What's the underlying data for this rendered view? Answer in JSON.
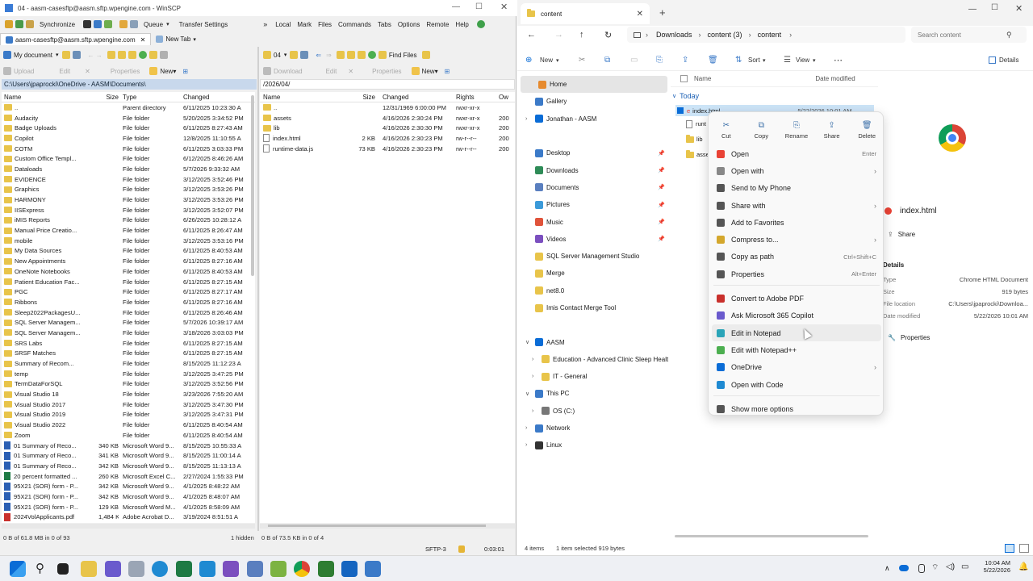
{
  "winscp": {
    "title": "04 - aasm-casesftp@aasm.sftp.wpengine.com - WinSCP",
    "toolbar1": [
      "Synchronize",
      "Queue",
      "Transfer Settings"
    ],
    "menu": [
      "Local",
      "Mark",
      "Files",
      "Commands",
      "Tabs",
      "Options",
      "Remote",
      "Help"
    ],
    "session_tab": "aasm-casesftp@aasm.sftp.wpengine.com",
    "new_tab": "New Tab",
    "left": {
      "location": "My document",
      "new_label": "New",
      "upload": "Upload",
      "edit": "Edit",
      "properties": "Properties",
      "path": "C:\\Users\\jpaprocki\\OneDrive - AASM\\Documents\\",
      "cols": [
        "Name",
        "Size",
        "Type",
        "Changed"
      ],
      "rows": [
        [
          "..",
          "",
          "Parent directory",
          "6/11/2025 10:23:30 A",
          "up"
        ],
        [
          "Audacity",
          "",
          "File folder",
          "5/20/2025 3:34:52 PM",
          "f"
        ],
        [
          "Badge Uploads",
          "",
          "File folder",
          "6/11/2025 8:27:43 AM",
          "f"
        ],
        [
          "Copilot",
          "",
          "File folder",
          "12/8/2025 11:10:55 A",
          "f"
        ],
        [
          "COTM",
          "",
          "File folder",
          "6/11/2025 3:03:33 PM",
          "f"
        ],
        [
          "Custom Office Templ...",
          "",
          "File folder",
          "6/12/2025 8:46:26 AM",
          "f"
        ],
        [
          "Dataloads",
          "",
          "File folder",
          "5/7/2026 9:33:32 AM",
          "f"
        ],
        [
          "EVIDENCE",
          "",
          "File folder",
          "3/12/2025 3:52:46 PM",
          "f"
        ],
        [
          "Graphics",
          "",
          "File folder",
          "3/12/2025 3:53:26 PM",
          "f"
        ],
        [
          "HARMONY",
          "",
          "File folder",
          "3/12/2025 3:53:26 PM",
          "f"
        ],
        [
          "IISExpress",
          "",
          "File folder",
          "3/12/2025 3:52:07 PM",
          "f"
        ],
        [
          "iMIS Reports",
          "",
          "File folder",
          "6/26/2025 10:28:12 A",
          "f"
        ],
        [
          "Manual Price Creatio...",
          "",
          "File folder",
          "6/11/2025 8:26:47 AM",
          "f"
        ],
        [
          "mobile",
          "",
          "File folder",
          "3/12/2025 3:53:16 PM",
          "f"
        ],
        [
          "My Data Sources",
          "",
          "File folder",
          "6/11/2025 8:40:53 AM",
          "f"
        ],
        [
          "New Appointments",
          "",
          "File folder",
          "6/11/2025 8:27:16 AM",
          "f"
        ],
        [
          "OneNote Notebooks",
          "",
          "File folder",
          "6/11/2025 8:40:53 AM",
          "f"
        ],
        [
          "Patient Education Fac...",
          "",
          "File folder",
          "6/11/2025 8:27:15 AM",
          "f"
        ],
        [
          "PGC",
          "",
          "File folder",
          "6/11/2025 8:27:17 AM",
          "f"
        ],
        [
          "Ribbons",
          "",
          "File folder",
          "6/11/2025 8:27:16 AM",
          "f"
        ],
        [
          "Sleep2022PackagesU...",
          "",
          "File folder",
          "6/11/2025 8:26:46 AM",
          "f"
        ],
        [
          "SQL Server Managem...",
          "",
          "File folder",
          "5/7/2026 10:39:17 AM",
          "f"
        ],
        [
          "SQL Server Managem...",
          "",
          "File folder",
          "3/18/2026 3:03:03 PM",
          "f"
        ],
        [
          "SRS Labs",
          "",
          "File folder",
          "6/11/2025 8:27:15 AM",
          "f"
        ],
        [
          "SRSF Matches",
          "",
          "File folder",
          "6/11/2025 8:27:15 AM",
          "f"
        ],
        [
          "Summary of Recom...",
          "",
          "File folder",
          "8/15/2025 11:12:23 A",
          "f"
        ],
        [
          "temp",
          "",
          "File folder",
          "3/12/2025 3:47:25 PM",
          "f"
        ],
        [
          "TermDataForSQL",
          "",
          "File folder",
          "3/12/2025 3:52:56 PM",
          "f"
        ],
        [
          "Visual Studio 18",
          "",
          "File folder",
          "3/23/2026 7:55:20 AM",
          "f"
        ],
        [
          "Visual Studio 2017",
          "",
          "File folder",
          "3/12/2025 3:47:30 PM",
          "f"
        ],
        [
          "Visual Studio 2019",
          "",
          "File folder",
          "3/12/2025 3:47:31 PM",
          "f"
        ],
        [
          "Visual Studio 2022",
          "",
          "File folder",
          "6/11/2025 8:40:54 AM",
          "f"
        ],
        [
          "Zoom",
          "",
          "File folder",
          "6/11/2025 8:40:54 AM",
          "f"
        ],
        [
          "01 Summary of Reco...",
          "340 KB",
          "Microsoft Word 9...",
          "8/15/2025 10:55:33 A",
          "w"
        ],
        [
          "01 Summary of Reco...",
          "341 KB",
          "Microsoft Word 9...",
          "8/15/2025 11:00:14 A",
          "w"
        ],
        [
          "01 Summary of Reco...",
          "342 KB",
          "Microsoft Word 9...",
          "8/15/2025 11:13:13 A",
          "w"
        ],
        [
          "20 percent formatted ...",
          "260 KB",
          "Microsoft Excel C...",
          "2/27/2024 1:55:33 PM",
          "x"
        ],
        [
          "95X21 (SOR) form - P...",
          "342 KB",
          "Microsoft Word 9...",
          "4/1/2025 8:48:22 AM",
          "w"
        ],
        [
          "95X21 (SOR) form - P...",
          "342 KB",
          "Microsoft Word 9...",
          "4/1/2025 8:48:07 AM",
          "w"
        ],
        [
          "95X21 (SOR) form - P...",
          "129 KB",
          "Microsoft Word M...",
          "4/1/2025 8:58:09 AM",
          "w"
        ],
        [
          "2024VolApplicants.pdf",
          "1,484 KB",
          "Adobe Acrobat D...",
          "3/19/2024 8:51:51 A",
          "p"
        ]
      ],
      "status": "0 B of 61.8 MB in 0 of 93",
      "hidden": "1 hidden"
    },
    "right": {
      "location": "04",
      "new_label": "New",
      "download": "Download",
      "edit": "Edit",
      "properties": "Properties",
      "find": "Find Files",
      "path": "/2026/04/",
      "cols": [
        "Name",
        "Size",
        "Changed",
        "Rights",
        "Ow"
      ],
      "rows": [
        [
          "..",
          "",
          "12/31/1969 6:00:00 PM",
          "rwxr-xr-x",
          "",
          "up"
        ],
        [
          "assets",
          "",
          "4/16/2026 2:30:24 PM",
          "rwxr-xr-x",
          "200",
          "f"
        ],
        [
          "lib",
          "",
          "4/16/2026 2:30:30 PM",
          "rwxr-xr-x",
          "200",
          "f"
        ],
        [
          "index.html",
          "2 KB",
          "4/16/2026 2:30:23 PM",
          "rw-r--r--",
          "200",
          "h"
        ],
        [
          "runtime-data.js",
          "73 KB",
          "4/16/2026 2:30:23 PM",
          "rw-r--r--",
          "200",
          "j"
        ]
      ],
      "status": "0 B of 73.5 KB in 0 of 4"
    },
    "protocol": "SFTP-3",
    "timer": "0:03:01"
  },
  "explorer": {
    "tab_title": "content",
    "breadcrumb": [
      "Downloads",
      "content (3)",
      "content"
    ],
    "search_placeholder": "Search content",
    "cmd": {
      "new": "New",
      "sort": "Sort",
      "view": "View",
      "details": "Details"
    },
    "nav": [
      {
        "label": "Home",
        "icon": "home-icon",
        "active": true
      },
      {
        "label": "Gallery",
        "icon": "gallery-icon"
      },
      {
        "label": "Jonathan - AASM",
        "icon": "cloud-icon",
        "exp": true
      },
      {
        "label": "",
        "icon": ""
      },
      {
        "label": "Desktop",
        "icon": "desktop-icon",
        "pin": true
      },
      {
        "label": "Downloads",
        "icon": "download-icon",
        "pin": true
      },
      {
        "label": "Documents",
        "icon": "documents-icon",
        "pin": true
      },
      {
        "label": "Pictures",
        "icon": "pictures-icon",
        "pin": true
      },
      {
        "label": "Music",
        "icon": "music-icon",
        "pin": true
      },
      {
        "label": "Videos",
        "icon": "videos-icon",
        "pin": true
      },
      {
        "label": "SQL Server Management Studio",
        "icon": "folder-icon"
      },
      {
        "label": "Merge",
        "icon": "folder-icon"
      },
      {
        "label": "net8.0",
        "icon": "folder-icon"
      },
      {
        "label": "Imis Contact Merge Tool",
        "icon": "folder-icon"
      },
      {
        "label": "",
        "icon": ""
      },
      {
        "label": "AASM",
        "icon": "org-icon",
        "open": true
      },
      {
        "label": "Education - Advanced Clinic Sleep Healt",
        "icon": "folder-icon",
        "indent": 1,
        "exp": true
      },
      {
        "label": "IT - General",
        "icon": "folder-icon",
        "indent": 1,
        "exp": true
      },
      {
        "label": "This PC",
        "icon": "pc-icon",
        "open": true
      },
      {
        "label": "OS (C:)",
        "icon": "drive-icon",
        "indent": 1,
        "exp": true
      },
      {
        "label": "Network",
        "icon": "network-icon",
        "exp": true
      },
      {
        "label": "Linux",
        "icon": "linux-icon",
        "exp": true
      }
    ],
    "file_cols": [
      "Name",
      "Date modified"
    ],
    "group": "Today",
    "files": [
      "index.html",
      "runt",
      "lib",
      "asse"
    ],
    "selected_date": "5/22/2026 10:01 AM",
    "preview": {
      "name": "index.html",
      "share": "Share",
      "details_title": "Details",
      "props": "Properties",
      "details": [
        [
          "Type",
          "Chrome HTML Document"
        ],
        [
          "Size",
          "919 bytes"
        ],
        [
          "File location",
          "C:\\Users\\jpaprocki\\Downloa..."
        ],
        [
          "Date modified",
          "5/22/2026 10:01 AM"
        ]
      ]
    },
    "status": [
      "4 items",
      "1 item selected  919 bytes"
    ]
  },
  "context_menu": {
    "quick": [
      "Cut",
      "Copy",
      "Rename",
      "Share",
      "Delete"
    ],
    "items": [
      {
        "label": "Open",
        "shortcut": "Enter",
        "icon": "chrome-icon",
        "color": "#e94235"
      },
      {
        "label": "Open with",
        "arrow": true,
        "icon": "open-with-icon",
        "color": "#888"
      },
      {
        "label": "Send to My Phone",
        "icon": "phone-icon",
        "color": "#555"
      },
      {
        "label": "Share with",
        "arrow": true,
        "icon": "share-with-icon",
        "color": "#555"
      },
      {
        "label": "Add to Favorites",
        "icon": "star-icon",
        "color": "#555"
      },
      {
        "label": "Compress to...",
        "arrow": true,
        "icon": "zip-icon",
        "color": "#d4a72c"
      },
      {
        "label": "Copy as path",
        "shortcut": "Ctrl+Shift+C",
        "icon": "path-icon",
        "color": "#555"
      },
      {
        "label": "Properties",
        "shortcut": "Alt+Enter",
        "icon": "wrench-icon",
        "color": "#555"
      },
      {
        "sep": true
      },
      {
        "label": "Convert to Adobe PDF",
        "icon": "pdf-icon",
        "color": "#c9302c"
      },
      {
        "label": "Ask Microsoft 365 Copilot",
        "icon": "copilot-icon",
        "color": "#6a5acd"
      },
      {
        "label": "Edit in Notepad",
        "icon": "notepad-icon",
        "color": "#2aa4b8",
        "hover": true
      },
      {
        "label": "Edit with Notepad++",
        "icon": "notepadpp-icon",
        "color": "#4caf50"
      },
      {
        "label": "OneDrive",
        "arrow": true,
        "icon": "onedrive-icon",
        "color": "#0a6cd6"
      },
      {
        "label": "Open with Code",
        "icon": "vscode-icon",
        "color": "#1f8ad2"
      },
      {
        "sep": true
      },
      {
        "label": "Show more options",
        "icon": "more-options-icon",
        "color": "#555"
      }
    ]
  },
  "taskbar": {
    "time": "10:04 AM",
    "date": "5/22/2026"
  }
}
